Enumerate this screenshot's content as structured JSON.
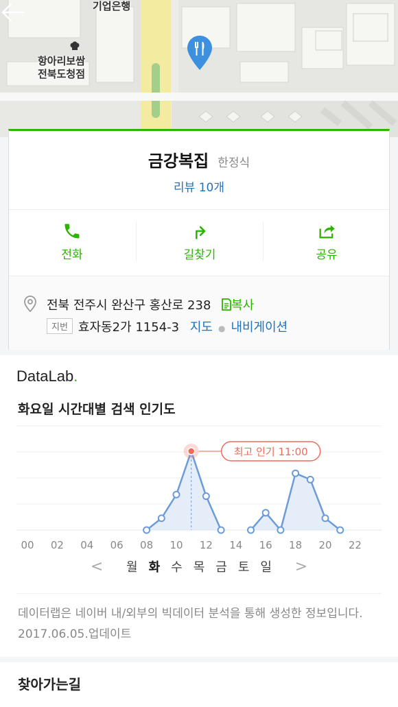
{
  "map": {
    "labels": {
      "bank": "기업은행",
      "restaurant": "항아리보쌈\n전북도청점"
    }
  },
  "place": {
    "name": "금강복집",
    "category": "한정식",
    "review": "리뷰 10개"
  },
  "actions": {
    "call": "전화",
    "route": "길찾기",
    "share": "공유"
  },
  "address": {
    "road": "전북 전주시 완산구 홍산로 238",
    "copy_label": "복사",
    "lot_badge": "지번",
    "lot": "효자동2가 1154-3",
    "map_link": "지도",
    "nav_link": "내비게이션"
  },
  "datalab": {
    "brand": "DataLab",
    "brand_dot": ".",
    "chart_title": "화요일 시간대별 검색 인기도",
    "days": [
      "월",
      "화",
      "수",
      "목",
      "금",
      "토",
      "일"
    ],
    "selected_day": "화",
    "note": "데이터랩은 네이버 내/외부의 빅데이터 분석을 통해 생성한 정보입니다. 2017.06.05.업데이트"
  },
  "directions": {
    "title": "찾아가는길"
  },
  "chart_data": {
    "type": "line",
    "title": "화요일 시간대별 검색 인기도",
    "x_ticks": [
      "00",
      "02",
      "04",
      "06",
      "08",
      "10",
      "12",
      "14",
      "16",
      "18",
      "20",
      "22"
    ],
    "segments": [
      {
        "x": [
          8,
          9,
          10,
          11,
          12,
          13
        ],
        "y": [
          0,
          15,
          45,
          100,
          43,
          0
        ]
      },
      {
        "x": [
          15,
          16,
          17,
          18,
          19,
          20,
          21
        ],
        "y": [
          0,
          22,
          0,
          72,
          64,
          15,
          0
        ]
      }
    ],
    "peak": {
      "x": 11,
      "label": "최고 인기 11:00"
    },
    "xlim": [
      0,
      23
    ],
    "ylim": [
      0,
      100
    ],
    "grid": true,
    "colors": {
      "line": "#6b9bd8",
      "fill": "#dfe9f7",
      "peak": "#f06a5a"
    }
  }
}
